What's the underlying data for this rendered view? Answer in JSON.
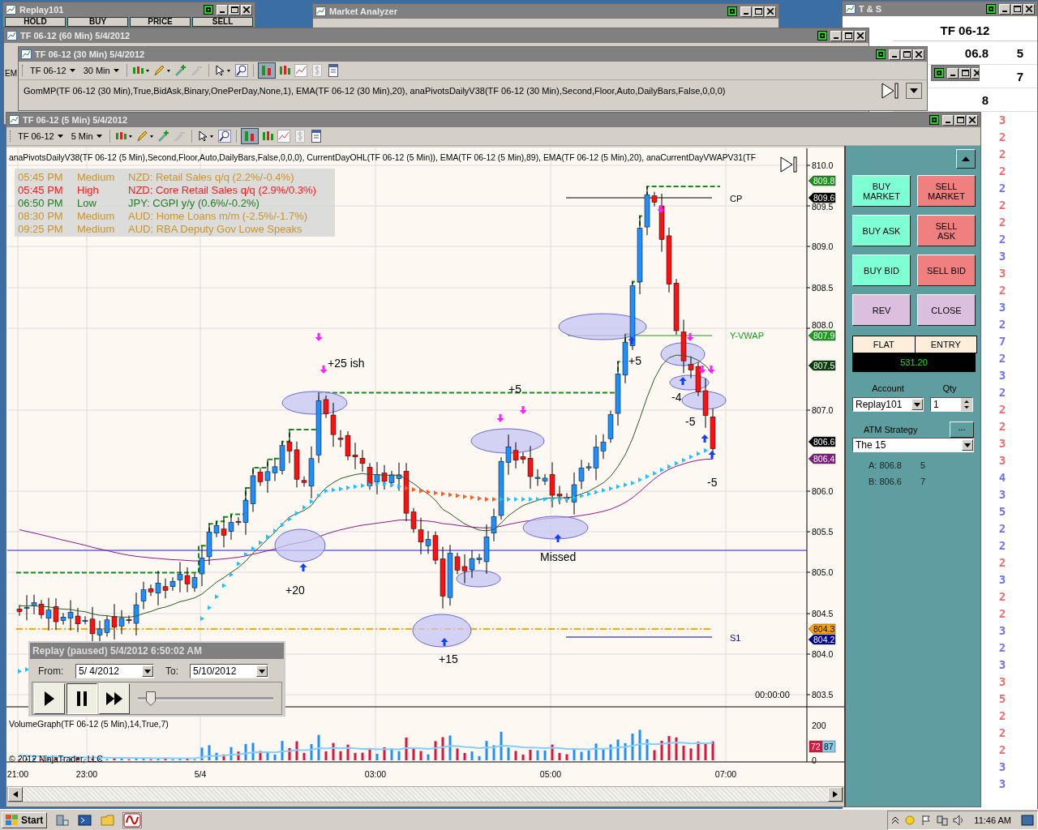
{
  "windows": {
    "replay101": {
      "title": "Replay101",
      "columns": [
        "HOLD",
        "BUY",
        "PRICE",
        "SELL"
      ]
    },
    "market_analyzer": {
      "title": "Market Analyzer"
    },
    "time_and_sales": {
      "title": "T & S",
      "instrument": "TF 06-12",
      "rows": [
        {
          "price": "06.8",
          "size": "5"
        },
        {
          "size": "7"
        },
        {
          "price": "8"
        }
      ],
      "ticks": [
        {
          "size": "3",
          "color": "#f06a6a"
        },
        {
          "size": "2",
          "color": "#f06a6a"
        },
        {
          "size": "2",
          "color": "#f06a6a"
        },
        {
          "size": "2",
          "color": "#f06a6a"
        },
        {
          "size": "2",
          "color": "#7070f0"
        },
        {
          "size": "2",
          "color": "#f06a6a"
        },
        {
          "size": "2",
          "color": "#f06a6a"
        },
        {
          "size": "2",
          "color": "#7070f0"
        },
        {
          "size": "3",
          "color": "#7070f0"
        },
        {
          "size": "3",
          "color": "#f06a6a"
        },
        {
          "size": "2",
          "color": "#f06a6a"
        },
        {
          "size": "3",
          "color": "#7070f0"
        },
        {
          "size": "2",
          "color": "#7070f0"
        },
        {
          "size": "7",
          "color": "#7070f0"
        },
        {
          "size": "2",
          "color": "#7070f0"
        },
        {
          "size": "3",
          "color": "#7070f0"
        },
        {
          "size": "2",
          "color": "#7070f0"
        },
        {
          "size": "2",
          "color": "#f06a6a"
        },
        {
          "size": "2",
          "color": "#f06a6a"
        },
        {
          "size": "3",
          "color": "#f06a6a"
        },
        {
          "size": "3",
          "color": "#f06a6a"
        },
        {
          "size": "4",
          "color": "#7070f0"
        },
        {
          "size": "3",
          "color": "#7070f0"
        },
        {
          "size": "5",
          "color": "#7070f0"
        },
        {
          "size": "2",
          "color": "#7070f0"
        },
        {
          "size": "2",
          "color": "#7070f0"
        },
        {
          "size": "2",
          "color": "#f06a6a"
        },
        {
          "size": "3",
          "color": "#7070f0"
        },
        {
          "size": "2",
          "color": "#f06a6a"
        },
        {
          "size": "2",
          "color": "#f06a6a"
        },
        {
          "size": "3",
          "color": "#7070f0"
        },
        {
          "size": "2",
          "color": "#7070f0"
        },
        {
          "size": "3",
          "color": "#7070f0"
        },
        {
          "size": "3",
          "color": "#f06a6a"
        },
        {
          "size": "5",
          "color": "#f06a6a"
        },
        {
          "size": "2",
          "color": "#f06a6a"
        },
        {
          "size": "2",
          "color": "#f06a6a"
        },
        {
          "size": "2",
          "color": "#f06a6a"
        },
        {
          "size": "3",
          "color": "#7070f0"
        },
        {
          "size": "3",
          "color": "#7070f0"
        }
      ]
    },
    "chart_60min": {
      "title": "TF 06-12 (60 Min)  5/4/2012",
      "side_text": "EM"
    },
    "chart_30min": {
      "title": "TF 06-12 (30 Min)  5/4/2012",
      "instrument": "TF 06-12",
      "interval": "30 Min",
      "indicators": "GomMP(TF 06-12 (30 Min),True,BidAsk,Binary,OnePerDay,None,1), EMA(TF 06-12 (30 Min),20), anaPivotsDailyV38(TF 06-12 (30 Min),Second,Floor,Auto,DailyBars,False,0,0,0)"
    }
  },
  "main_window": {
    "title": "TF 06-12 (5 Min)  5/4/2012",
    "instrument": "TF 06-12",
    "interval": "5 Min",
    "indicators": "anaPivotsDailyV38(TF 06-12 (5 Min),Second,Floor,Auto,DailyBars,False,0,0,0), CurrentDayOHL(TF 06-12 (5 Min)), EMA(TF 06-12 (5 Min),89), EMA(TF 06-12 (5 Min),20), anaCurrentDayVWAPV31(TF",
    "news": [
      {
        "time": "05:45 PM",
        "impact": "Medium",
        "kind": "medium",
        "event": "NZD: Retail Sales q/q (2.2%/-0.4%)"
      },
      {
        "time": "05:45 PM",
        "impact": "High",
        "kind": "high",
        "event": "NZD: Core Retail Sales q/q (2.9%/0.3%)"
      },
      {
        "time": "06:50 PM",
        "impact": "Low",
        "kind": "low",
        "event": "JPY: CGPI y/y (0.6%/-0.2%)"
      },
      {
        "time": "08:30 PM",
        "impact": "Medium",
        "kind": "medium",
        "event": "AUD: Home Loans m/m (-2.5%/-1.7%)"
      },
      {
        "time": "09:25 PM",
        "impact": "Medium",
        "kind": "medium",
        "event": "AUD: RBA Deputy Gov Lowe Speaks"
      }
    ],
    "price_axis": [
      "810.0",
      "809.5",
      "809.0",
      "808.5",
      "808.0",
      "807.0",
      "806.0",
      "805.5",
      "805.0",
      "804.5",
      "804.0",
      "803.5"
    ],
    "price_markers": [
      {
        "text": "809.8",
        "color": "#1a8c1a"
      },
      {
        "text": "809.6",
        "color": "#000000"
      },
      {
        "text": "807.9",
        "color": "#1f9a1f"
      },
      {
        "text": "807.5",
        "color": "#0a3a0a"
      },
      {
        "text": "806.6",
        "color": "#000000"
      },
      {
        "text": "806.4",
        "color": "#7a1f7a"
      },
      {
        "text": "804.3",
        "color": "#ffa500"
      },
      {
        "text": "804.2",
        "color": "#00008b"
      }
    ],
    "level_labels": [
      {
        "text": "CP",
        "color": "#000000"
      },
      {
        "text": "Y-VWAP",
        "color": "#1f9a1f"
      },
      {
        "text": "S1",
        "color": "#00008b"
      }
    ],
    "annotations": [
      "+25 ish",
      "+5",
      "+5",
      "-4",
      "-5",
      "-5",
      "+20",
      "+15",
      "Missed"
    ],
    "session_timer": "00:00:00",
    "volume": {
      "title": "VolumeGraph(TF 06-12 (5 Min),14,True,7)",
      "axis": [
        "200",
        "0"
      ],
      "markers": [
        {
          "text": "72",
          "color": "#dc143c"
        },
        {
          "text": "87",
          "color": "#87ceeb"
        }
      ]
    },
    "copyright": "© 2012 NinjaTrader, LLC",
    "time_axis": [
      "21:00",
      "23:00",
      "5/4",
      "03:00",
      "05:00",
      "07:00"
    ]
  },
  "order_panel": {
    "buttons": [
      {
        "label": "BUY MARKET",
        "kind": "buy"
      },
      {
        "label": "SELL MARKET",
        "kind": "sell"
      },
      {
        "label": "BUY ASK",
        "kind": "buy"
      },
      {
        "label": "SELL ASK",
        "kind": "sell"
      },
      {
        "label": "BUY BID",
        "kind": "buy"
      },
      {
        "label": "SELL BID",
        "kind": "sell"
      },
      {
        "label": "REV",
        "kind": "neutral"
      },
      {
        "label": "CLOSE",
        "kind": "neutral"
      }
    ],
    "position": "FLAT",
    "entry_label": "ENTRY",
    "pnl": "531.20",
    "account_label": "Account",
    "account": "Replay101",
    "qty_label": "Qty",
    "qty": "1",
    "atm_label": "ATM Strategy",
    "atm_more": "...",
    "atm_strategy": "The 15",
    "quotes": [
      {
        "label": "A: 806.8",
        "size": "5"
      },
      {
        "label": "B: 806.6",
        "size": "7"
      }
    ]
  },
  "replay": {
    "title": "Replay (paused) 5/4/2012 6:50:02 AM",
    "from_label": "From:",
    "from": "5/  4/2012",
    "to_label": "To:",
    "to": "5/10/2012",
    "level": 0.06
  },
  "taskbar": {
    "start": "Start",
    "clock": "11:46 AM"
  }
}
